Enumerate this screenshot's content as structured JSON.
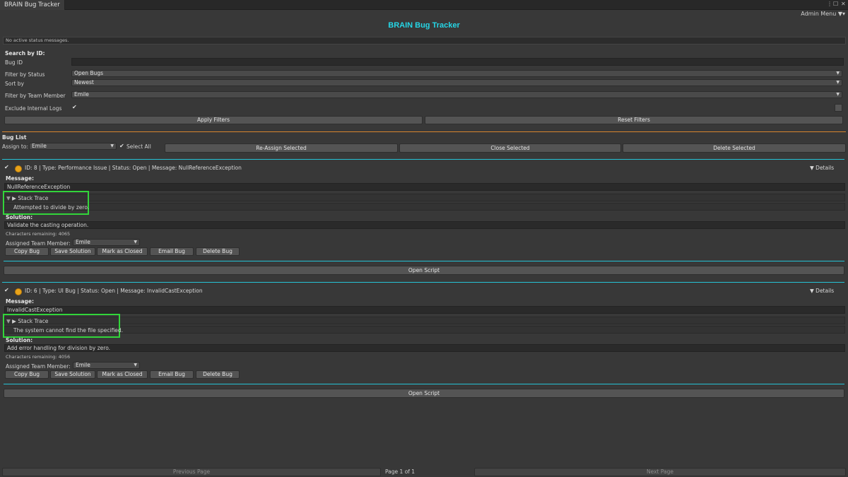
{
  "window": {
    "tab_title": "BRAIN Bug Tracker",
    "menu_label": "⋮",
    "maximize_label": "☐",
    "close_label": "✕"
  },
  "admin_menu": {
    "label": "Admin Menu"
  },
  "page_title": "BRAIN Bug Tracker",
  "status_message": "No active status messages.",
  "filters": {
    "search_heading": "Search by ID:",
    "bug_id_label": "Bug ID",
    "bug_id_value": "",
    "status_label": "Filter by Status",
    "status_value": "Open Bugs",
    "sort_label": "Sort by",
    "sort_value": "Newest",
    "team_label": "Filter by Team Member",
    "team_value": "Emile",
    "exclude_label": "Exclude Internal Logs",
    "exclude_checked": "✔",
    "apply_label": "Apply Filters",
    "reset_label": "Reset Filters"
  },
  "bug_list": {
    "heading": "Bug List",
    "assign_label": "Assign to:",
    "assign_value": "Emile",
    "select_all_label": "Select All",
    "select_all_check": "✔",
    "reassign_label": "Re-Assign Selected",
    "close_selected_label": "Close Selected",
    "delete_selected_label": "Delete Selected"
  },
  "bugs": [
    {
      "checked": "✔",
      "header": "ID: 8 | Type: Performance Issue | Status: Open | Message: NullReferenceException",
      "details_label": "Details",
      "message_label": "Message:",
      "message": "NullReferenceException",
      "stack_trace_label": "Stack Trace",
      "stack_trace": "Attempted to divide by zero.",
      "solution_label": "Solution:",
      "solution": "Validate the casting operation.",
      "chars_remaining": "Characters remaining: 4065",
      "assigned_label": "Assigned Team Member:",
      "assigned_value": "Emile",
      "copy_label": "Copy Bug",
      "save_label": "Save Solution",
      "mark_closed_label": "Mark as Closed",
      "email_label": "Email Bug",
      "delete_label": "Delete Bug",
      "open_script_label": "Open Script"
    },
    {
      "checked": "✔",
      "header": "ID: 6 | Type: UI Bug | Status: Open | Message: InvalidCastException",
      "details_label": "Details",
      "message_label": "Message:",
      "message": "InvalidCastException",
      "stack_trace_label": "Stack Trace",
      "stack_trace": "The system cannot find the file specified.",
      "solution_label": "Solution:",
      "solution": "Add error handling for division by zero.",
      "chars_remaining": "Characters remaining: 4056",
      "assigned_label": "Assigned Team Member:",
      "assigned_value": "Emile",
      "copy_label": "Copy Bug",
      "save_label": "Save Solution",
      "mark_closed_label": "Mark as Closed",
      "email_label": "Email Bug",
      "delete_label": "Delete Bug",
      "open_script_label": "Open Script"
    }
  ],
  "pagination": {
    "previous_label": "Previous Page",
    "page_info": "Page 1 of 1",
    "next_label": "Next Page"
  },
  "colors": {
    "title": "#25d6e6",
    "orange_rule": "#d8852e",
    "cyan_rule": "#25c3d6",
    "highlight_box": "#32d53a",
    "coin": "#e8a31a"
  }
}
